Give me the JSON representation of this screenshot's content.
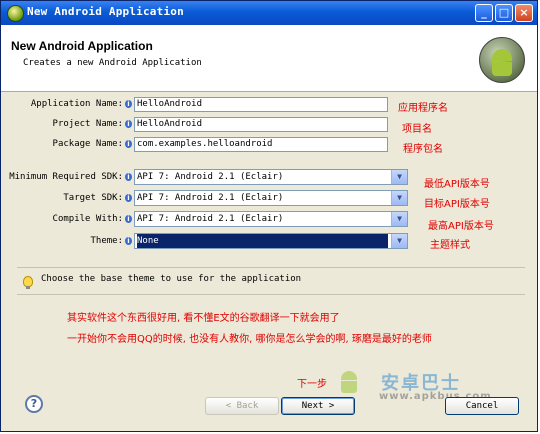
{
  "window": {
    "title": "New Android Application",
    "minimize_glyph": "_",
    "maximize_glyph": "□",
    "close_glyph": "×"
  },
  "header": {
    "title": "New Android Application",
    "subtitle": "Creates a new Android Application",
    "logo_icon": "android-droid-icon"
  },
  "form": {
    "app_name": {
      "label": "Application Name:",
      "value": "HelloAndroid",
      "note": "应用程序名"
    },
    "project_name": {
      "label": "Project Name:",
      "value": "HelloAndroid",
      "note": "项目名"
    },
    "package_name": {
      "label": "Package Name:",
      "value": "com.examples.helloandroid",
      "note": "程序包名"
    },
    "min_sdk": {
      "label": "Minimum Required SDK:",
      "value": "API 7: Android 2.1 (Eclair)",
      "note": "最低API版本号"
    },
    "target_sdk": {
      "label": "Target SDK:",
      "value": "API 7: Android 2.1 (Eclair)",
      "note": "目标API版本号"
    },
    "compile_with": {
      "label": "Compile With:",
      "value": "API 7: Android 2.1 (Eclair)",
      "note": "最高API版本号"
    },
    "theme": {
      "label": "Theme:",
      "value": "None",
      "note": "主题样式"
    },
    "info_glyph": "i"
  },
  "hint": {
    "text": "Choose the base theme to use for the application"
  },
  "annotations": {
    "line1": "其实软件这个东西很好用, 看不懂E文的谷歌翻译一下就会用了",
    "line2": "一开始你不会用QQ的时候, 也没有人教你, 哪你是怎么学会的啊, 琢磨是最好的老师",
    "next_step": "下一步"
  },
  "buttons": {
    "help_glyph": "?",
    "back": "< Back",
    "next": "Next >",
    "cancel": "Cancel"
  },
  "watermark": {
    "brand": "安卓巴士",
    "url": "www.apkbus.com"
  },
  "colors": {
    "annotation_red": "#e00000",
    "selection_blue": "#0a246a",
    "titlebar_blue": "#0a5bd6"
  }
}
